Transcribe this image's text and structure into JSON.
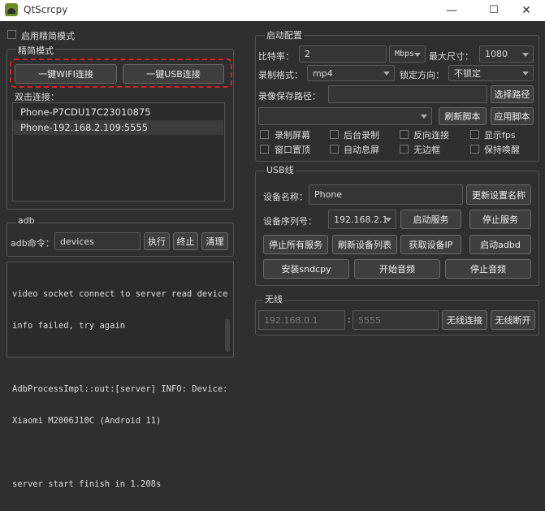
{
  "window": {
    "title": "QtScrcpy",
    "minimize": "—",
    "maximize": "☐",
    "close": "✕"
  },
  "simple_mode": {
    "checkbox_label": "启用精简模式",
    "group_title": "精简模式",
    "wifi_button": "一键WIFI连接",
    "usb_button": "一键USB连接",
    "accent": "#e02020"
  },
  "devices": {
    "label": "双击连接：",
    "items": [
      "Phone-P7CDU17C23010875",
      "Phone-192.168.2.109:5555"
    ]
  },
  "adb": {
    "group_title": "adb",
    "cmd_label": "adb命令：",
    "cmd_value": "devices",
    "exec": "执行",
    "stop": "终止",
    "clear": "清理"
  },
  "log": {
    "lines": [
      "video socket connect to server read device",
      "info failed, try again",
      "",
      "AdbProcessImpl::out:[server] INFO: Device:",
      "Xiaomi M2006J10C (Android 11)",
      "",
      "server start finish in 1.208s"
    ]
  },
  "start_config": {
    "group_title": "启动配置",
    "bitrate_label": "比特率：",
    "bitrate_value": "2",
    "bitrate_unit": "Mbps",
    "max_size_label": "最大尺寸：",
    "max_size_value": "1080",
    "record_format_label": "录制格式：",
    "record_format_value": "mp4",
    "lock_dir_label": "锁定方向：",
    "lock_dir_value": "不锁定",
    "record_path_label": "录像保存路径：",
    "select_path": "选择路径",
    "script_value": "",
    "refresh_script": "刷新脚本",
    "apply_script": "应用脚本",
    "options": [
      "录制屏幕",
      "后台录制",
      "反向连接",
      "显示fps",
      "窗口置顶",
      "自动息屏",
      "无边框",
      "保持唤醒"
    ]
  },
  "usb": {
    "group_title": "USB线",
    "device_name_label": "设备名称：",
    "device_name_value": "Phone",
    "update_name": "更新设置名称",
    "serial_label": "设备序列号：",
    "serial_value": "192.168.2.1",
    "start_service": "启动服务",
    "stop_service": "停止服务",
    "stop_all": "停止所有服务",
    "refresh_list": "刷新设备列表",
    "get_ip": "获取设备IP",
    "start_adbd": "启动adbd",
    "install_sndcpy": "安装sndcpy",
    "start_audio": "开始音频",
    "stop_audio": "停止音频"
  },
  "wireless": {
    "group_title": "无线",
    "ip_placeholder": "192.168.0.1",
    "separator": ":",
    "port_placeholder": "5555",
    "connect": "无线连接",
    "disconnect": "无线断开"
  }
}
